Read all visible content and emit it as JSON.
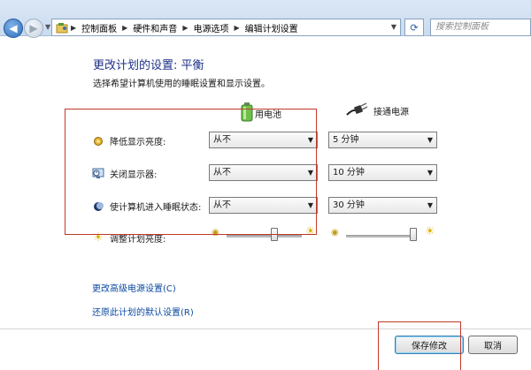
{
  "address_bar": {
    "breadcrumbs": [
      "控制面板",
      "硬件和声音",
      "电源选项",
      "编辑计划设置"
    ],
    "search_placeholder": "搜索控制面板",
    "icons": {
      "back": "arrow-left-icon",
      "forward": "arrow-right-icon",
      "refresh": "refresh-icon",
      "folder": "control-panel-icon"
    }
  },
  "page": {
    "title": "更改计划的设置: 平衡",
    "subtitle": "选择希望计算机使用的睡眠设置和显示设置。",
    "columns": {
      "battery": "用电池",
      "plugged": "接通电源"
    }
  },
  "settings": [
    {
      "label": "降低显示亮度:",
      "icon": "dim-brightness-icon",
      "battery": "从不",
      "plugged": "5 分钟"
    },
    {
      "label": "关闭显示器:",
      "icon": "monitor-clock-icon",
      "battery": "从不",
      "plugged": "10 分钟"
    },
    {
      "label": "使计算机进入睡眠状态:",
      "icon": "moon-icon",
      "battery": "从不",
      "plugged": "30 分钟"
    }
  ],
  "brightness": {
    "label": "调整计划亮度:",
    "icon": "sun-icon",
    "battery_level": 0.65,
    "plugged_level": 1.0
  },
  "links": {
    "advanced": "更改高级电源设置(C)",
    "restore": "还原此计划的默认设置(R)"
  },
  "buttons": {
    "save": "保存修改",
    "cancel": "取消"
  },
  "colors": {
    "title": "#1e3287",
    "link": "#0b4aa1",
    "annotation": "#c0392b"
  }
}
